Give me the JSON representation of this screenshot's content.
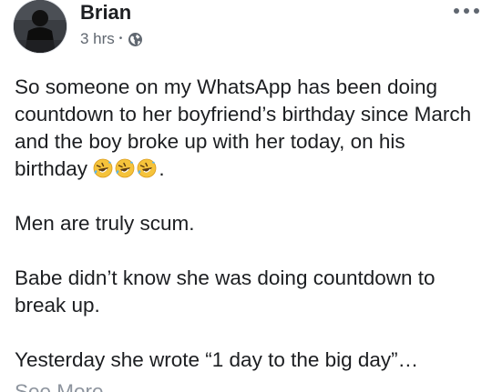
{
  "post": {
    "author": "Brian",
    "timestamp": "3 hrs",
    "separator": "•",
    "privacy_icon": "globe-icon",
    "menu_icon": "more-options-icon",
    "paragraphs": {
      "p1": "So someone on my WhatsApp has been doing countdown to her boyfriend’s birthday since March and the boy broke up with her today, on his birthday ",
      "p1_end": ".",
      "p2": "Men are truly scum.",
      "p3": "Babe didn’t know she was doing countdown to break up.",
      "p4": "Yesterday she wrote “1 day to the big day”…"
    },
    "emoji_count": 3,
    "emoji_name": "rolling-on-the-floor-laughing-emoji",
    "see_more_label": "See More"
  },
  "colors": {
    "text": "#1c1e21",
    "meta": "#606770",
    "see_more": "#8d949e",
    "emoji_face": "#f5c33b"
  }
}
